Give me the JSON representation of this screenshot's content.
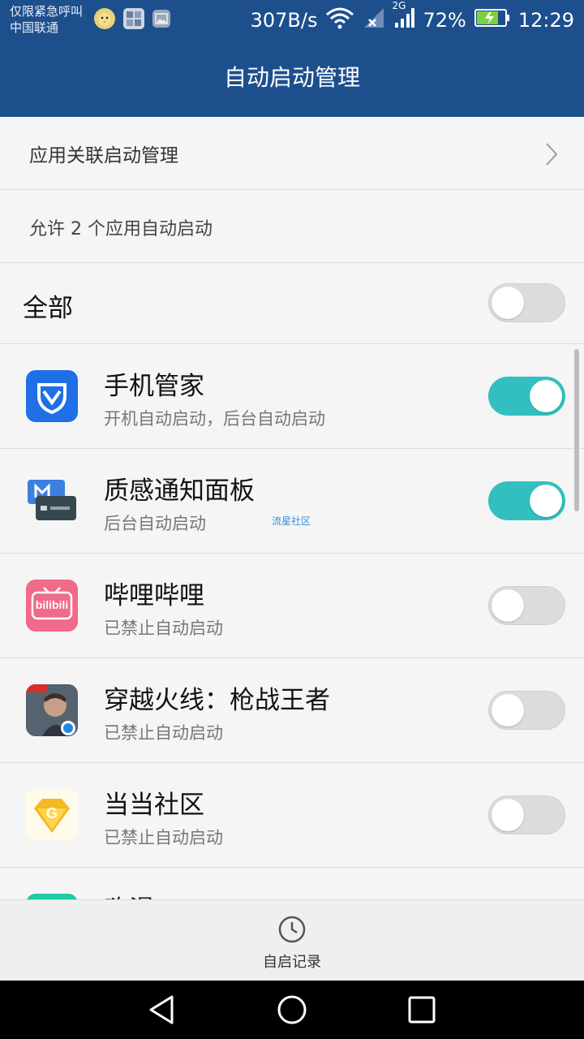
{
  "status_bar": {
    "carrier_line1": "仅限紧急呼叫",
    "carrier_line2": "中国联通",
    "network_speed": "307B/s",
    "network_type": "2G",
    "battery": "72%",
    "time": "12:29",
    "icons": [
      "notification-chick-icon",
      "notification-people-icon",
      "notification-gallery-icon",
      "wifi-icon",
      "no-sim-signal-icon",
      "signal-icon",
      "battery-charging-icon"
    ]
  },
  "header": {
    "title": "自动启动管理"
  },
  "link_row": {
    "label": "应用关联启动管理"
  },
  "info_row": {
    "label": "允许 2 个应用自动启动"
  },
  "all_row": {
    "label": "全部",
    "enabled": false
  },
  "apps": [
    {
      "name": "手机管家",
      "desc": "开机自动启动，后台自动启动",
      "enabled": true,
      "icon": "shield-icon"
    },
    {
      "name": "质感通知面板",
      "desc": "后台自动启动",
      "enabled": true,
      "icon": "notification-panel-icon",
      "watermark": "流星社区"
    },
    {
      "name": "哔哩哔哩",
      "desc": "已禁止自动启动",
      "enabled": false,
      "icon": "bilibili-icon",
      "icon_text": "bilibili"
    },
    {
      "name": "穿越火线：枪战王者",
      "desc": "已禁止自动启动",
      "enabled": false,
      "icon": "game-character-icon"
    },
    {
      "name": "当当社区",
      "desc": "已禁止自动启动",
      "enabled": false,
      "icon": "diamond-g-icon",
      "icon_text": "G"
    },
    {
      "name": "嗨漫",
      "desc": "",
      "enabled": false,
      "icon": "teal-app-icon"
    }
  ],
  "bottom": {
    "record_label": "自启记录"
  },
  "colors": {
    "header": "#1e4f8d",
    "toggle_on": "#33bfbf",
    "toggle_off": "#dcdcdc"
  }
}
